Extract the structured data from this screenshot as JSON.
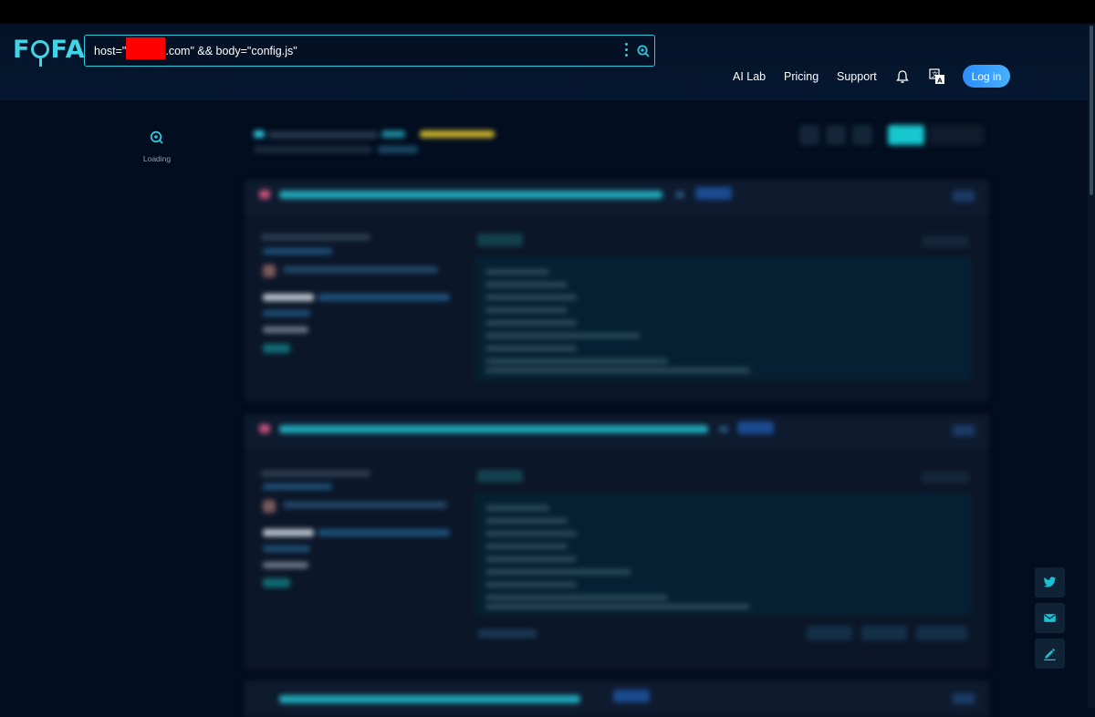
{
  "logo": "FOFA",
  "search": {
    "query_prefix": "host=\"",
    "query_suffix": ".com\" && body=\"config.js\""
  },
  "nav": {
    "ai_lab": "AI Lab",
    "pricing": "Pricing",
    "support": "Support",
    "login": "Log in"
  },
  "sidebar": {
    "loading_label": "Loading"
  },
  "colors": {
    "accent": "#2ec8dc",
    "login_button": "#3aa0ff",
    "redaction": "#ff0000",
    "background": "#020d1f"
  },
  "icons": {
    "search": "search-icon",
    "menu": "kebab-menu-icon",
    "notifications": "bell-icon",
    "language": "translate-icon",
    "twitter": "twitter-icon",
    "email": "mail-icon",
    "feedback": "edit-icon"
  }
}
